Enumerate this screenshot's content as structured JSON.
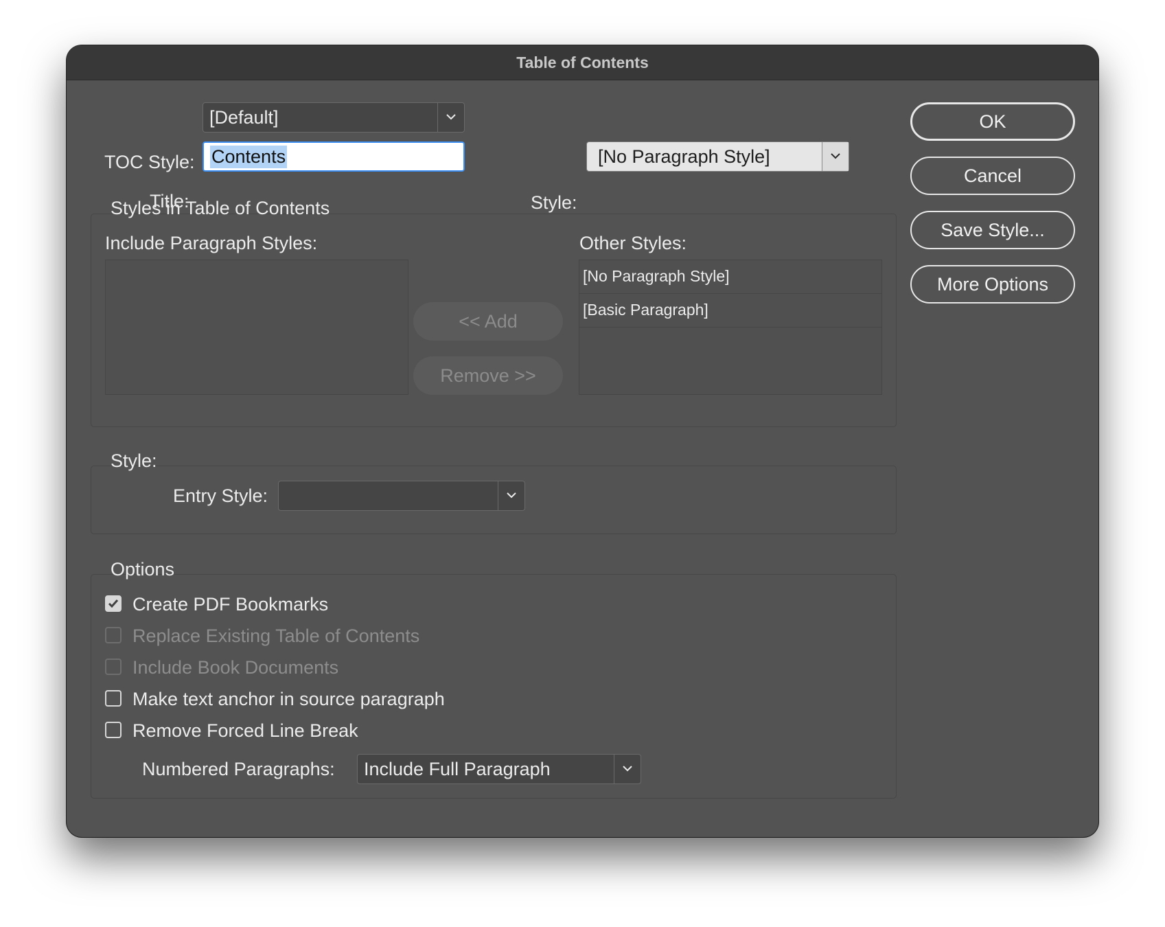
{
  "window": {
    "title": "Table of Contents"
  },
  "top": {
    "toc_style_label": "TOC Style:",
    "toc_style_value": "[Default]",
    "title_label": "Title:",
    "title_value": "Contents",
    "style_label": "Style:",
    "style_value": "[No Paragraph Style]"
  },
  "styles_group": {
    "title": "Styles in Table of Contents",
    "include_label": "Include Paragraph Styles:",
    "include_items": [],
    "add_label": "<< Add",
    "remove_label": "Remove >>",
    "other_label": "Other Styles:",
    "other_items": [
      "[No Paragraph Style]",
      "[Basic Paragraph]"
    ]
  },
  "style_group": {
    "title": "Style:",
    "entry_style_label": "Entry Style:",
    "entry_style_value": ""
  },
  "options_group": {
    "title": "Options",
    "checkboxes": [
      {
        "label": "Create PDF Bookmarks",
        "checked": true,
        "enabled": true
      },
      {
        "label": "Replace Existing Table of Contents",
        "checked": false,
        "enabled": false
      },
      {
        "label": "Include Book Documents",
        "checked": false,
        "enabled": false
      },
      {
        "label": "Make text anchor in source paragraph",
        "checked": false,
        "enabled": true
      },
      {
        "label": "Remove Forced Line Break",
        "checked": false,
        "enabled": true
      }
    ],
    "numbered_label": "Numbered Paragraphs:",
    "numbered_value": "Include Full Paragraph"
  },
  "buttons": {
    "ok": "OK",
    "cancel": "Cancel",
    "save_style": "Save Style...",
    "more_options": "More Options"
  },
  "icons": {
    "dropdown": "chevron-down-icon",
    "check": "checkmark-icon"
  },
  "colors": {
    "dialog_bg": "#535353",
    "titlebar_bg": "#383838",
    "focus_ring": "#3b8ef0",
    "selection": "#b2d3f5"
  }
}
